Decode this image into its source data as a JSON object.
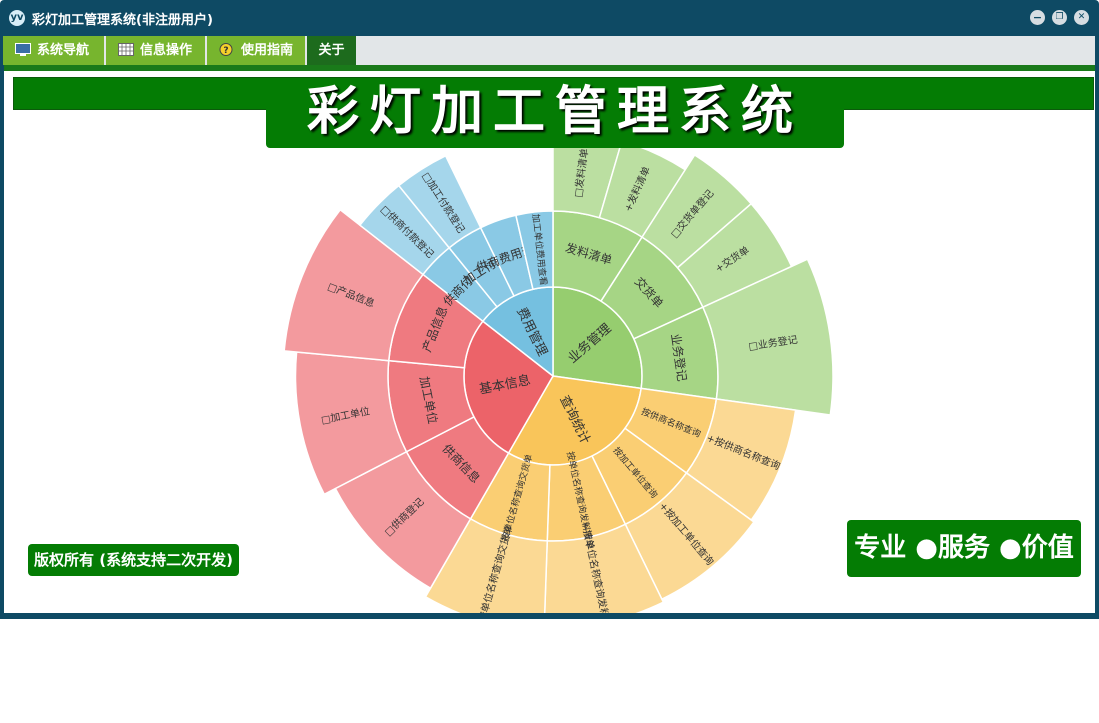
{
  "window": {
    "title": "彩灯加工管理系统(非注册用户)",
    "app_icon": "yv",
    "controls": {
      "minimize": "−",
      "restore": "❐",
      "close": "✕"
    }
  },
  "menu": [
    {
      "label": "系统导航",
      "icon": "monitor-icon"
    },
    {
      "label": "信息操作",
      "icon": "grid-icon"
    },
    {
      "label": "使用指南",
      "icon": "help-icon"
    },
    {
      "label": "关于",
      "icon": ""
    }
  ],
  "banner_title": "彩灯加工管理系统",
  "copyright": "版权所有 (系统支持二次开发)",
  "slogan": "专业 ●服务 ●价值",
  "colors": {
    "titlebar": "#0e4a64",
    "menu_green": "#77b52e",
    "banner_green": "#047c04",
    "business": "#96cd6f",
    "query": "#f9c55a",
    "basic": "#ec6369",
    "expense": "#75c0e0"
  },
  "chart_data": {
    "type": "sunburst",
    "children": [
      {
        "name": "业务管理",
        "color": "#96cd6f",
        "children": [
          {
            "name": "发料清单",
            "children": [
              {
                "name": "□发料清单"
              },
              {
                "name": "+发料清单"
              }
            ]
          },
          {
            "name": "交货单",
            "children": [
              {
                "name": "□交货单登记"
              },
              {
                "name": "+交货单"
              }
            ]
          },
          {
            "name": "业务登记",
            "children": [
              {
                "name": "□业务登记"
              }
            ]
          }
        ]
      },
      {
        "name": "查询统计",
        "color": "#f9c55a",
        "children": [
          {
            "name": "按供商名称查询",
            "children": [
              {
                "name": "+按供商名称查询"
              }
            ]
          },
          {
            "name": "按加工单位查询",
            "children": [
              {
                "name": "+按加工单位查询"
              }
            ]
          },
          {
            "name": "按单位名称查询发料清单",
            "children": [
              {
                "name": "+按单位名称查询发料清单"
              }
            ]
          },
          {
            "name": "按单位名称查询交货单",
            "children": [
              {
                "name": "+按单位名称查询交货单"
              }
            ]
          }
        ]
      },
      {
        "name": "基本信息",
        "color": "#ec6369",
        "children": [
          {
            "name": "供商信息",
            "children": [
              {
                "name": "□供商登记"
              }
            ]
          },
          {
            "name": "加工单位",
            "children": [
              {
                "name": "□加工单位"
              }
            ]
          },
          {
            "name": "产品信息",
            "children": [
              {
                "name": "□产品信息"
              }
            ]
          }
        ]
      },
      {
        "name": "费用管理",
        "color": "#75c0e0",
        "children": [
          {
            "name": "供商付款",
            "children": [
              {
                "name": "□供商付款登记"
              }
            ]
          },
          {
            "name": "加工付款",
            "children": [
              {
                "name": "□加工付款登记"
              }
            ]
          },
          {
            "name": "供商费用查看",
            "children": []
          },
          {
            "name": "加工单位费用查看",
            "children": []
          }
        ]
      }
    ]
  }
}
